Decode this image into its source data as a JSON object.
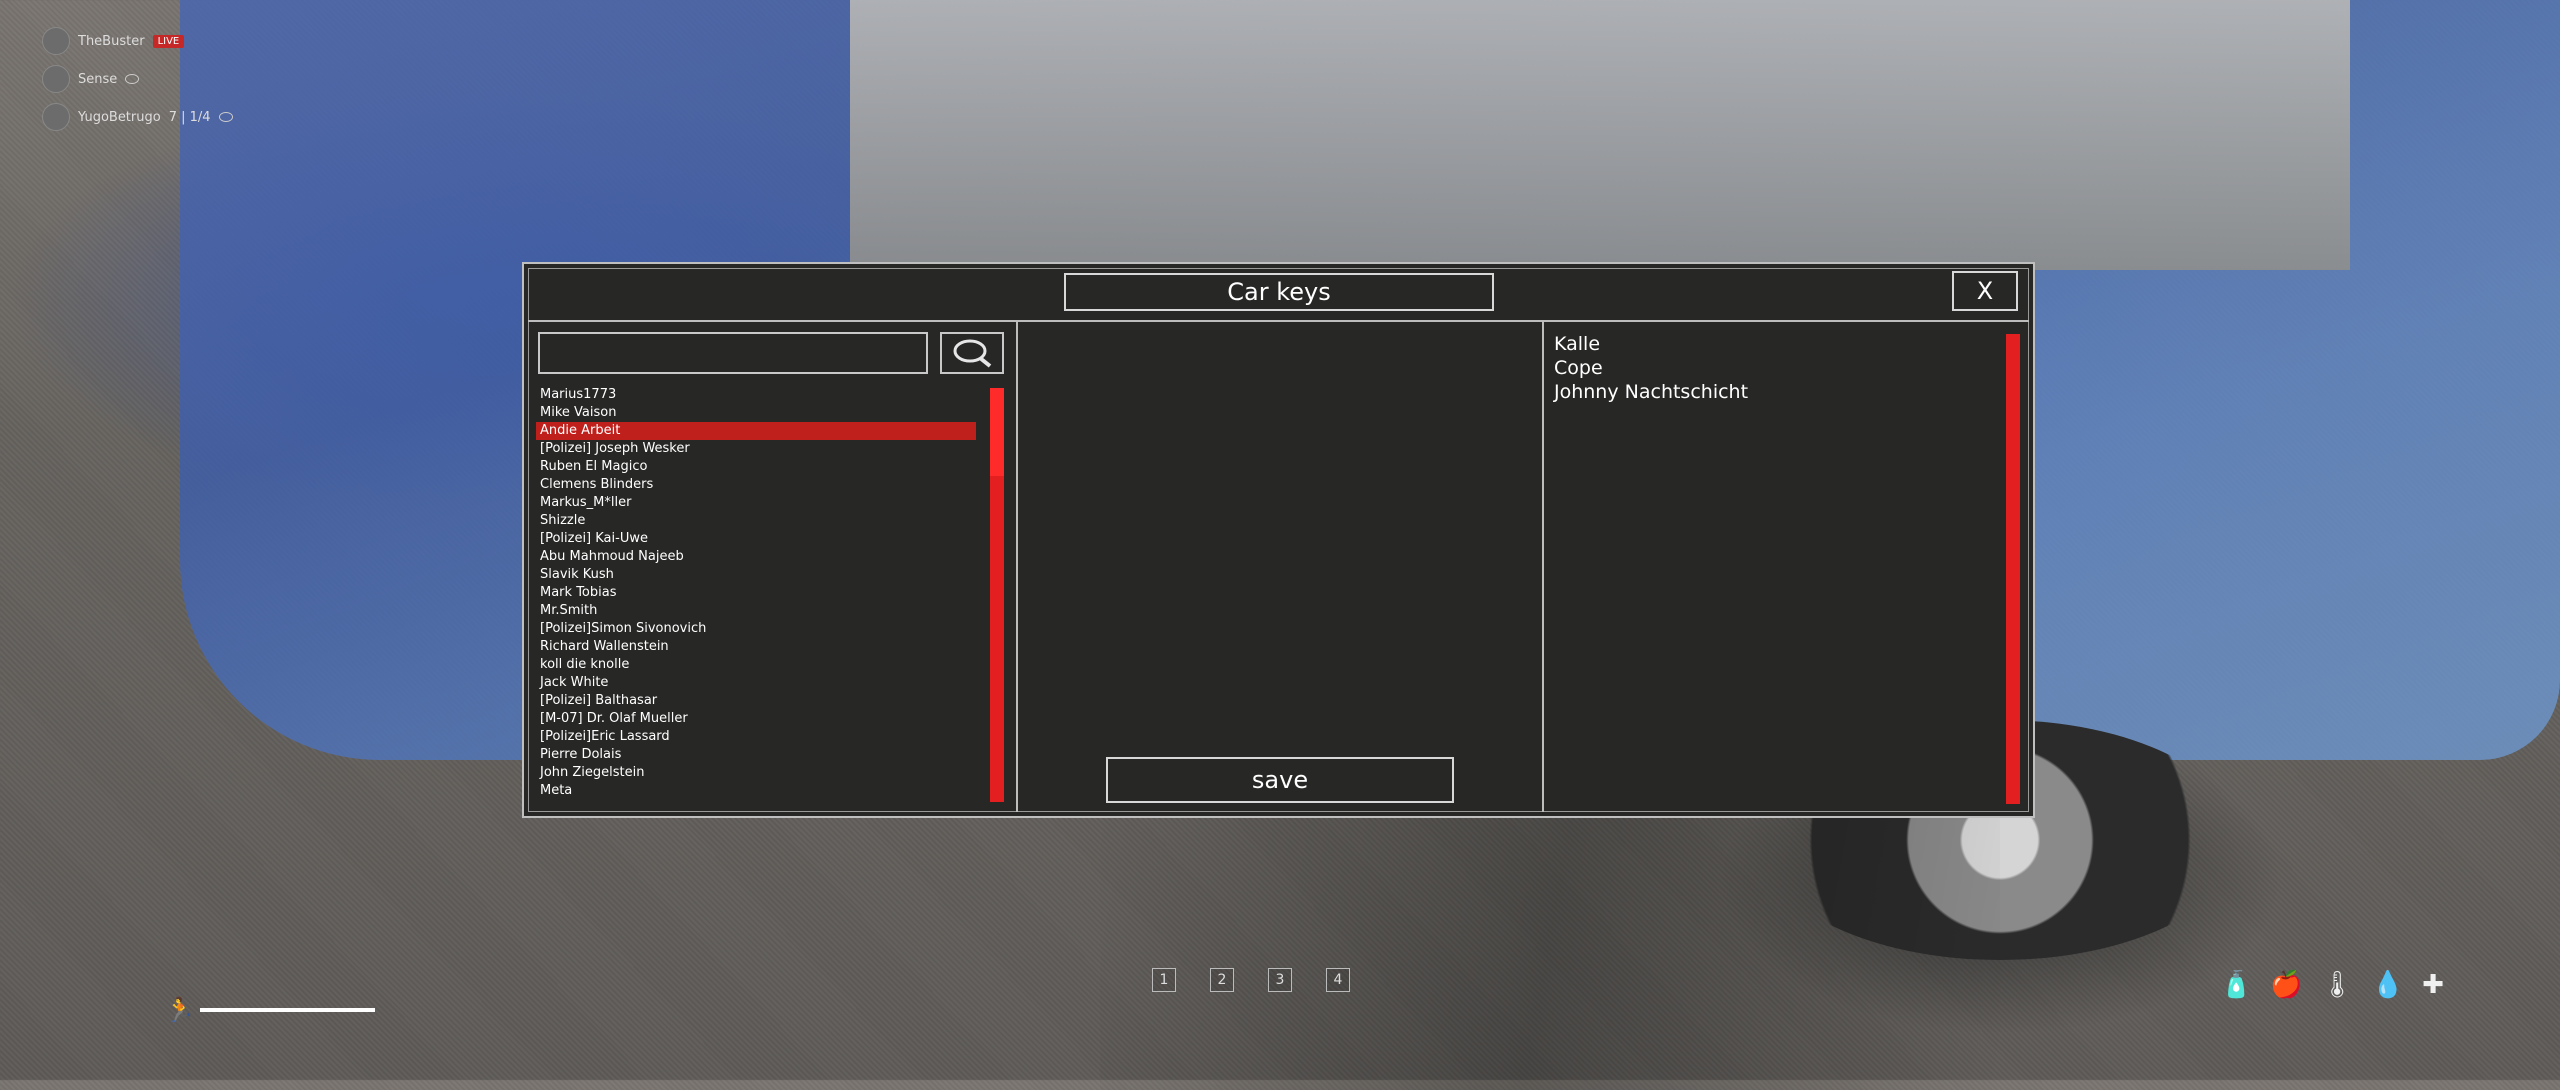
{
  "stream_overlay": [
    {
      "name": "TheBuster",
      "badge": "LIVE"
    },
    {
      "name": "Sense"
    },
    {
      "name": "YugoBetrugo",
      "extra": "7 | 1/4"
    }
  ],
  "dialog": {
    "title": "Car keys",
    "close_label": "X",
    "search": {
      "value": "",
      "placeholder": ""
    },
    "players": [
      "Marius1773",
      "Mike Vaison",
      "Andie Arbeit",
      "[Polizei] Joseph Wesker",
      "Ruben El Magico",
      "Clemens Blinders",
      "Markus_M*ller",
      "Shizzle",
      "[Polizei] Kai-Uwe",
      "Abu Mahmoud Najeeb",
      "Slavik Kush",
      "Mark Tobias",
      "Mr.Smith",
      "[Polizei]Simon Sivonovich",
      "Richard Wallenstein",
      "koll die knolle",
      "Jack White",
      "[Polizei] Balthasar",
      "[M-07] Dr. Olaf Mueller",
      "[Polizei]Eric Lassard",
      "Pierre Dolais",
      "John Ziegelstein",
      "Meta"
    ],
    "selected_player": "Andie Arbeit",
    "save_label": "save",
    "key_holders": [
      "Kalle",
      "Cope",
      "Johnny Nachtschicht"
    ],
    "accent_color": "#e41f1f"
  },
  "hotbar": [
    "1",
    "2",
    "3",
    "4"
  ],
  "stamina_level": 1.0,
  "status_icons": [
    "bottle-icon",
    "food-icon",
    "thermometer-icon",
    "water-drop-icon",
    "health-icon"
  ]
}
